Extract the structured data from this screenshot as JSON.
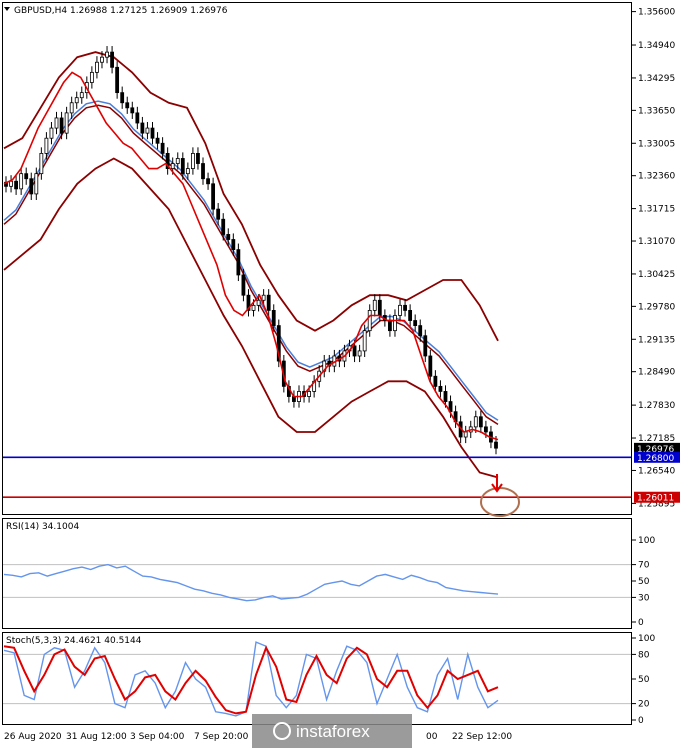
{
  "chart_data": [
    {
      "type": "candlestick",
      "title": "GBPUSD,H4  1.26988 1.27125 1.26909 1.26976",
      "ylim": [
        1.2568,
        1.3575
      ],
      "y_ticks": [
        1.356,
        1.3494,
        1.3429,
        1.3365,
        1.33,
        1.3236,
        1.3171,
        1.3107,
        1.3042,
        1.2978,
        1.2913,
        1.2849,
        1.2783,
        1.2718,
        1.2654,
        1.2589
      ],
      "y_tick_labels": [
        "1.35600",
        "1.34940",
        "1.34295",
        "1.33650",
        "1.33005",
        "1.32360",
        "1.31715",
        "1.31070",
        "1.30425",
        "1.29780",
        "1.29135",
        "1.28490",
        "1.27830",
        "1.27185",
        "1.26540",
        "1.25895"
      ],
      "x_tick_labels": [
        "26 Aug 2020",
        "31 Aug 12:00",
        "3 Sep 04:00",
        "7 Sep 20:00",
        "00",
        "22 Sep 12:00"
      ],
      "price_labels": [
        {
          "text": "1.26976",
          "value": 1.26976,
          "color": "#000000"
        },
        {
          "text": "1.26800",
          "value": 1.268,
          "color": "#0000cc"
        },
        {
          "text": "1.26011",
          "value": 1.26011,
          "color": "#cc0000"
        }
      ],
      "hlines": [
        {
          "value": 1.268,
          "color": "#0000cc"
        },
        {
          "value": 1.26011,
          "color": "#cc0000"
        }
      ],
      "close": [
        1.3215,
        1.3225,
        1.321,
        1.324,
        1.323,
        1.32,
        1.324,
        1.328,
        1.331,
        1.333,
        1.335,
        1.332,
        1.336,
        1.338,
        1.339,
        1.34,
        1.342,
        1.344,
        1.346,
        1.347,
        1.348,
        1.345,
        1.34,
        1.338,
        1.337,
        1.336,
        1.334,
        1.332,
        1.333,
        1.331,
        1.33,
        1.328,
        1.325,
        1.326,
        1.327,
        1.324,
        1.325,
        1.328,
        1.326,
        1.323,
        1.322,
        1.317,
        1.315,
        1.312,
        1.311,
        1.309,
        1.304,
        1.3,
        1.297,
        1.298,
        1.299,
        1.3,
        1.297,
        1.294,
        1.287,
        1.282,
        1.28,
        1.279,
        1.281,
        1.28,
        1.281,
        1.283,
        1.285,
        1.287,
        1.286,
        1.288,
        1.287,
        1.289,
        1.29,
        1.288,
        1.289,
        1.293,
        1.297,
        1.299,
        1.296,
        1.295,
        1.293,
        1.296,
        1.298,
        1.297,
        1.295,
        1.294,
        1.292,
        1.288,
        1.284,
        1.282,
        1.281,
        1.279,
        1.277,
        1.275,
        1.272,
        1.273,
        1.274,
        1.276,
        1.274,
        1.273,
        1.271,
        1.2698
      ],
      "ma_fast": [
        1.322,
        1.3228,
        1.325,
        1.329,
        1.333,
        1.336,
        1.339,
        1.342,
        1.344,
        1.343,
        1.34,
        1.337,
        1.334,
        1.332,
        1.33,
        1.329,
        1.327,
        1.325,
        1.325,
        1.326,
        1.324,
        1.322,
        1.318,
        1.314,
        1.31,
        1.306,
        1.3,
        1.297,
        1.296,
        1.298,
        1.3,
        1.296,
        1.29,
        1.283,
        1.28,
        1.28,
        1.282,
        1.284,
        1.286,
        1.287,
        1.288,
        1.29,
        1.294,
        1.296,
        1.296,
        1.295,
        1.295,
        1.295,
        1.293,
        1.288,
        1.283,
        1.28,
        1.278,
        1.275,
        1.273,
        1.2735,
        1.273,
        1.272,
        1.2715
      ],
      "ma_slow": [
        1.314,
        1.316,
        1.32,
        1.324,
        1.328,
        1.332,
        1.335,
        1.337,
        1.3375,
        1.337,
        1.335,
        1.332,
        1.33,
        1.328,
        1.326,
        1.324,
        1.321,
        1.318,
        1.314,
        1.31,
        1.306,
        1.301,
        1.297,
        1.293,
        1.289,
        1.286,
        1.285,
        1.286,
        1.287,
        1.289,
        1.291,
        1.293,
        1.295,
        1.295,
        1.294,
        1.292,
        1.29,
        1.288,
        1.285,
        1.282,
        1.279,
        1.276,
        1.2745
      ],
      "bb_upper": [
        1.329,
        1.331,
        1.337,
        1.343,
        1.347,
        1.348,
        1.347,
        1.344,
        1.34,
        1.338,
        1.337,
        1.33,
        1.32,
        1.314,
        1.306,
        1.3,
        1.295,
        1.293,
        1.295,
        1.298,
        1.3,
        1.3,
        1.299,
        1.301,
        1.303,
        1.303,
        1.298,
        1.291
      ],
      "bb_lower": [
        1.305,
        1.308,
        1.311,
        1.317,
        1.322,
        1.325,
        1.327,
        1.325,
        1.321,
        1.317,
        1.31,
        1.303,
        1.296,
        1.29,
        1.283,
        1.276,
        1.273,
        1.273,
        1.276,
        1.279,
        1.281,
        1.283,
        1.283,
        1.281,
        1.276,
        1.27,
        1.265,
        1.264
      ]
    },
    {
      "type": "line",
      "title": "RSI(14) 34.1004",
      "ylim": [
        0,
        100
      ],
      "y_tick_labels": [
        "100",
        "70",
        "50",
        "30",
        "0"
      ],
      "y_ticks": [
        100,
        70,
        50,
        30,
        0
      ],
      "levels": [
        70,
        30
      ],
      "values": [
        58,
        57,
        55,
        59,
        60,
        56,
        59,
        62,
        65,
        67,
        64,
        68,
        70,
        66,
        68,
        62,
        56,
        55,
        52,
        50,
        48,
        44,
        40,
        38,
        35,
        33,
        30,
        28,
        26,
        27,
        30,
        32,
        28,
        29,
        30,
        34,
        40,
        46,
        48,
        50,
        46,
        44,
        50,
        56,
        58,
        55,
        52,
        57,
        54,
        50,
        48,
        42,
        40,
        38,
        37,
        36,
        35,
        34
      ]
    },
    {
      "type": "line",
      "title": "Stoch(5,3,3) 24.4621 40.5144",
      "ylim": [
        0,
        100
      ],
      "y_tick_labels": [
        "100",
        "80",
        "50",
        "20",
        "0"
      ],
      "y_ticks": [
        100,
        80,
        50,
        20,
        0
      ],
      "levels": [
        80,
        20
      ],
      "series": [
        {
          "name": "main",
          "color": "#6495ed",
          "values": [
            85,
            82,
            30,
            25,
            80,
            88,
            85,
            40,
            60,
            88,
            70,
            20,
            15,
            55,
            60,
            45,
            15,
            35,
            70,
            50,
            40,
            10,
            8,
            5,
            10,
            95,
            90,
            30,
            15,
            30,
            80,
            75,
            25,
            60,
            90,
            85,
            70,
            20,
            50,
            80,
            40,
            15,
            10,
            55,
            75,
            25,
            80,
            40,
            15,
            24
          ]
        },
        {
          "name": "signal",
          "color": "#e00000",
          "values": [
            90,
            88,
            60,
            35,
            55,
            80,
            86,
            65,
            55,
            75,
            78,
            50,
            25,
            35,
            52,
            55,
            35,
            25,
            45,
            60,
            48,
            28,
            12,
            8,
            10,
            55,
            88,
            65,
            25,
            22,
            55,
            78,
            55,
            45,
            75,
            88,
            80,
            50,
            40,
            60,
            60,
            30,
            15,
            30,
            60,
            50,
            55,
            60,
            35,
            40
          ]
        }
      ]
    }
  ],
  "watermark": {
    "text": "instaforex"
  }
}
